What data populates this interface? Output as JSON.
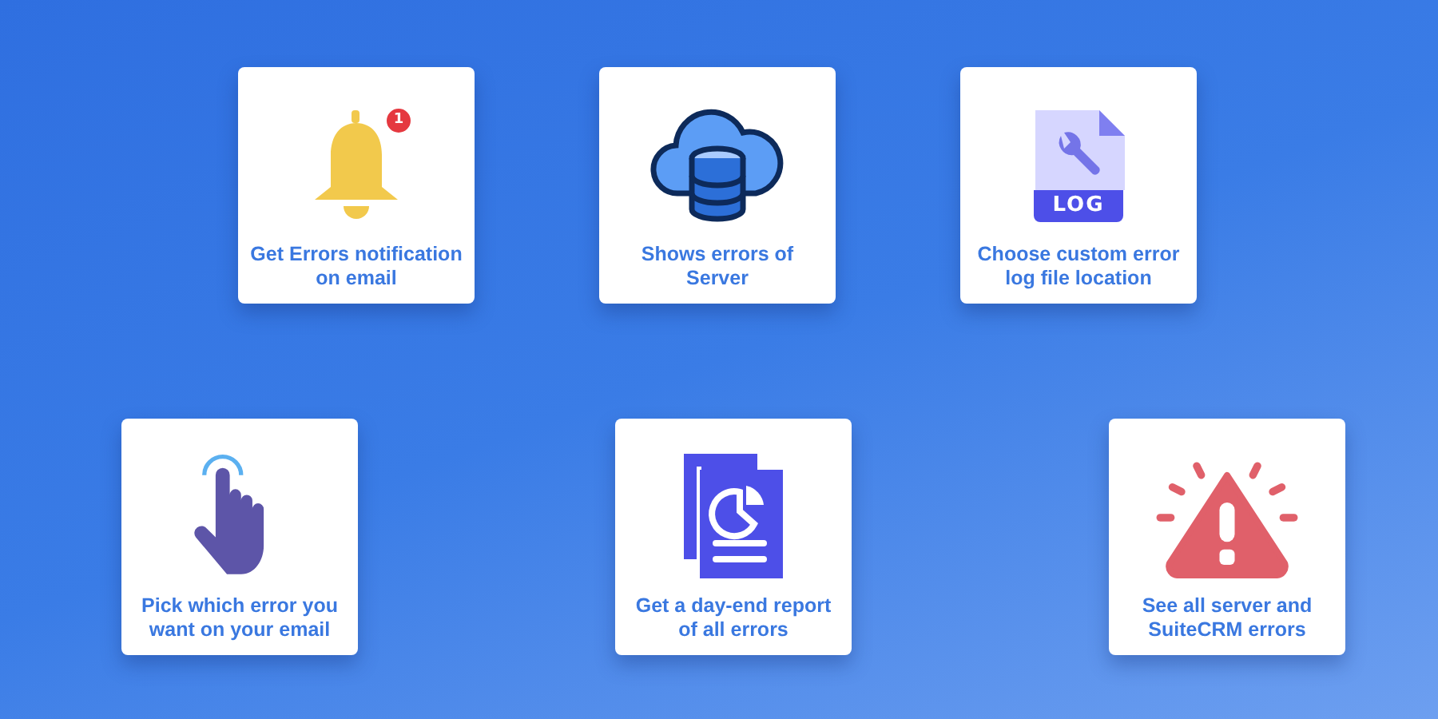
{
  "rows": [
    {
      "cards": [
        {
          "kind": "bell",
          "badge": "1",
          "label": "Get Errors notification on email"
        },
        {
          "kind": "cloud-database",
          "label": "Shows errors of Server"
        },
        {
          "kind": "log-file",
          "icon_label": "LOG",
          "label": "Choose custom error log file location"
        }
      ]
    },
    {
      "cards": [
        {
          "kind": "hand",
          "label": "Pick which error you want on your email"
        },
        {
          "kind": "report",
          "label": "Get a day-end report of all errors"
        },
        {
          "kind": "warning",
          "label": "See all server and SuiteCRM errors"
        }
      ]
    }
  ]
}
